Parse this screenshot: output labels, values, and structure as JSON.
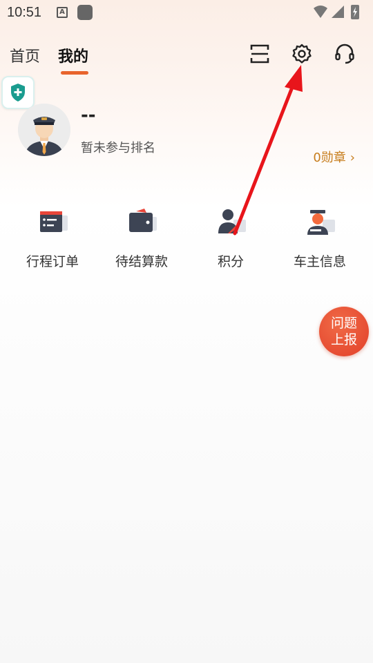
{
  "status_bar": {
    "time": "10:51",
    "icons": [
      "text-a-icon",
      "app-square-icon",
      "wifi-icon",
      "signal-icon",
      "battery-charging-icon"
    ]
  },
  "topnav": {
    "tabs": [
      {
        "label": "首页",
        "active": false
      },
      {
        "label": "我的",
        "active": true
      }
    ],
    "accent_color": "#e8642c",
    "icons": [
      "scan-icon",
      "settings-icon",
      "customer-service-icon"
    ]
  },
  "shield": {
    "icon": "shield-plus-icon",
    "color": "#1a9c8f"
  },
  "profile": {
    "name": "--",
    "rank_text": "暂未参与排名",
    "medal_text": "0勋章",
    "medal_color": "#c77d1d"
  },
  "functions": [
    {
      "label": "行程订单",
      "icon": "trip-order-icon"
    },
    {
      "label": "待结算款",
      "icon": "wallet-icon"
    },
    {
      "label": "积分",
      "icon": "points-icon"
    },
    {
      "label": "车主信息",
      "icon": "driver-info-icon"
    }
  ],
  "report_button": {
    "line1": "问题",
    "line2": "上报",
    "color": "#e8472e"
  },
  "annotation": {
    "arrow_color": "#e8151b",
    "points_to": "settings-icon"
  }
}
